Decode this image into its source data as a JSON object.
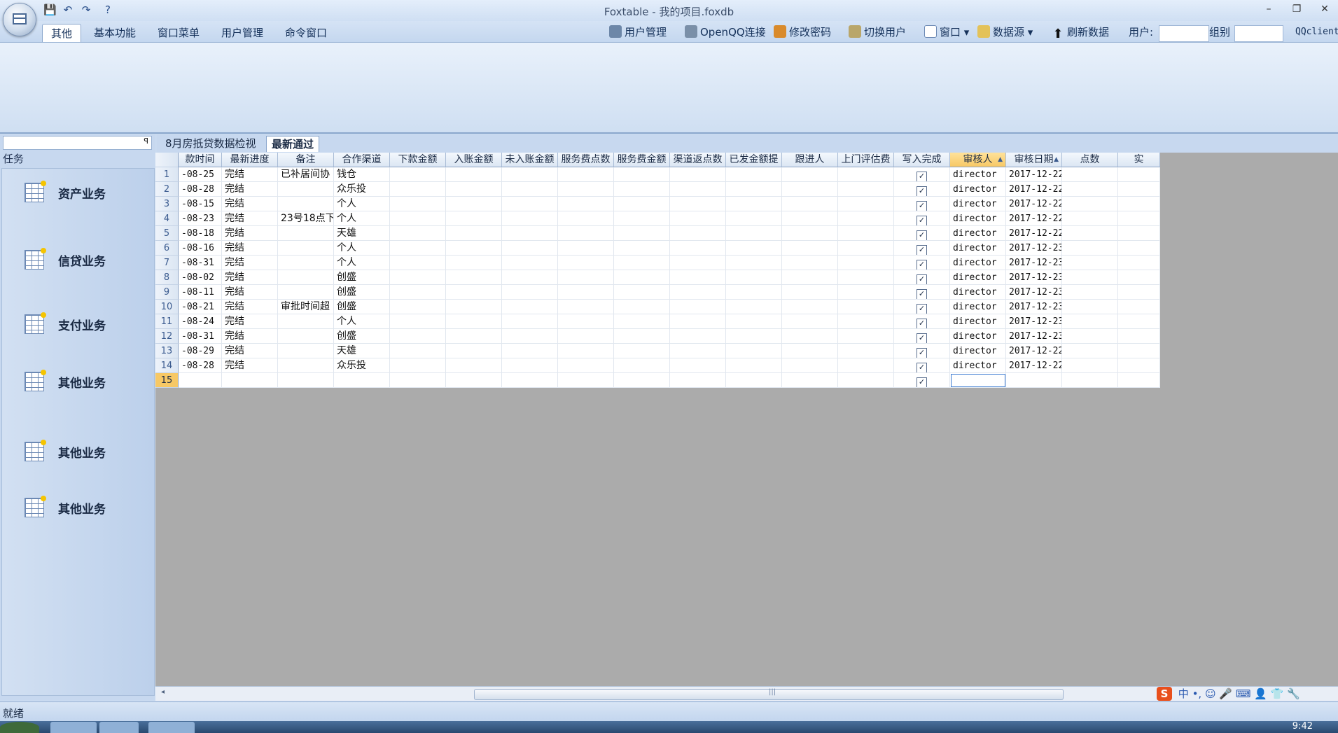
{
  "window": {
    "title": "Foxtable - 我的项目.foxdb",
    "min_glyph": "–",
    "restore_glyph": "❐",
    "close_glyph": "✕"
  },
  "ribbon_tabs": [
    "其他",
    "基本功能",
    "窗口菜单",
    "用户管理",
    "命令窗口"
  ],
  "toolbar": {
    "user_mgmt": "用户管理",
    "openqq": "OpenQQ连接",
    "change_pwd": "修改密码",
    "switch_user": "切换用户",
    "window": "窗口 ▾",
    "datasource": "数据源 ▾",
    "refresh": "刷新数据",
    "user_label": "用户:",
    "group_label": "组别",
    "qq_client": "QQclient"
  },
  "left_panel": {
    "header": "任务",
    "tasks": [
      "资产业务",
      "信贷业务",
      "支付业务",
      "其他业务",
      "其他业务",
      "其他业务"
    ]
  },
  "doc_tabs": [
    "8月房抵贷数据检视",
    "最新通过"
  ],
  "grid": {
    "columns": [
      "款时间",
      "最新进度",
      "备注",
      "合作渠道",
      "下款金额",
      "入账金额",
      "未入账金额",
      "服务费点数",
      "服务费金额",
      "渠道返点数",
      "已发金额提",
      "跟进人",
      "上门评估费",
      "写入完成",
      "审核人",
      "审核日期",
      "点数",
      "实"
    ],
    "rows": [
      {
        "n": "1",
        "c": [
          "-08-25",
          "完结",
          "已补居间协",
          "钱仓",
          "",
          "",
          "",
          "",
          "",
          "",
          "",
          "",
          "",
          "✓",
          "director",
          "2017-12-22",
          "",
          ""
        ]
      },
      {
        "n": "2",
        "c": [
          "-08-28",
          "完结",
          "",
          "众乐投",
          "",
          "",
          "",
          "",
          "",
          "",
          "",
          "",
          "",
          "✓",
          "director",
          "2017-12-22",
          "",
          ""
        ]
      },
      {
        "n": "3",
        "c": [
          "-08-15",
          "完结",
          "",
          "个人",
          "",
          "",
          "",
          "",
          "",
          "",
          "",
          "",
          "",
          "✓",
          "director",
          "2017-12-22",
          "",
          ""
        ]
      },
      {
        "n": "4",
        "c": [
          "-08-23",
          "完结",
          "23号18点下",
          "个人",
          "",
          "",
          "",
          "",
          "",
          "",
          "",
          "",
          "",
          "✓",
          "director",
          "2017-12-22",
          "",
          ""
        ]
      },
      {
        "n": "5",
        "c": [
          "-08-18",
          "完结",
          "",
          "天雄",
          "",
          "",
          "",
          "",
          "",
          "",
          "",
          "",
          "",
          "✓",
          "director",
          "2017-12-22",
          "",
          ""
        ]
      },
      {
        "n": "6",
        "c": [
          "-08-16",
          "完结",
          "",
          "个人",
          "",
          "",
          "",
          "",
          "",
          "",
          "",
          "",
          "",
          "✓",
          "director",
          "2017-12-23",
          "",
          ""
        ]
      },
      {
        "n": "7",
        "c": [
          "-08-31",
          "完结",
          "",
          "个人",
          "",
          "",
          "",
          "",
          "",
          "",
          "",
          "",
          "",
          "✓",
          "director",
          "2017-12-23",
          "",
          ""
        ]
      },
      {
        "n": "8",
        "c": [
          "-08-02",
          "完结",
          "",
          "创盛",
          "",
          "",
          "",
          "",
          "",
          "",
          "",
          "",
          "",
          "✓",
          "director",
          "2017-12-23",
          "",
          ""
        ]
      },
      {
        "n": "9",
        "c": [
          "-08-11",
          "完结",
          "",
          "创盛",
          "",
          "",
          "",
          "",
          "",
          "",
          "",
          "",
          "",
          "✓",
          "director",
          "2017-12-23",
          "",
          ""
        ]
      },
      {
        "n": "10",
        "c": [
          "-08-21",
          "完结",
          "审批时间超",
          "创盛",
          "",
          "",
          "",
          "",
          "",
          "",
          "",
          "",
          "",
          "✓",
          "director",
          "2017-12-23",
          "",
          ""
        ]
      },
      {
        "n": "11",
        "c": [
          "-08-24",
          "完结",
          "",
          "个人",
          "",
          "",
          "",
          "",
          "",
          "",
          "",
          "",
          "",
          "✓",
          "director",
          "2017-12-23",
          "",
          ""
        ]
      },
      {
        "n": "12",
        "c": [
          "-08-31",
          "完结",
          "",
          "创盛",
          "",
          "",
          "",
          "",
          "",
          "",
          "",
          "",
          "",
          "✓",
          "director",
          "2017-12-23",
          "",
          ""
        ]
      },
      {
        "n": "13",
        "c": [
          "-08-29",
          "完结",
          "",
          "天雄",
          "",
          "",
          "",
          "",
          "",
          "",
          "",
          "",
          "",
          "✓",
          "director",
          "2017-12-22",
          "",
          ""
        ]
      },
      {
        "n": "14",
        "c": [
          "-08-28",
          "完结",
          "",
          "众乐投",
          "",
          "",
          "",
          "",
          "",
          "",
          "",
          "",
          "",
          "✓",
          "director",
          "2017-12-22",
          "",
          ""
        ]
      },
      {
        "n": "15",
        "c": [
          "",
          "",
          "",
          "",
          "",
          "",
          "",
          "",
          "",
          "",
          "",
          "",
          "",
          "✓",
          "",
          "",
          "",
          ""
        ]
      }
    ]
  },
  "status": "就绪",
  "clock": "9:42",
  "ime": {
    "logo": "S",
    "mode": "中",
    "punct": "•,",
    "emoji": "☺",
    "mic": "🎤",
    "kbd": "⌨",
    "user": "👤",
    "shirt": "👕",
    "tool": "🔧"
  },
  "colors": {
    "selected_header": "#f7c865",
    "accent": "#3b7ad1"
  }
}
